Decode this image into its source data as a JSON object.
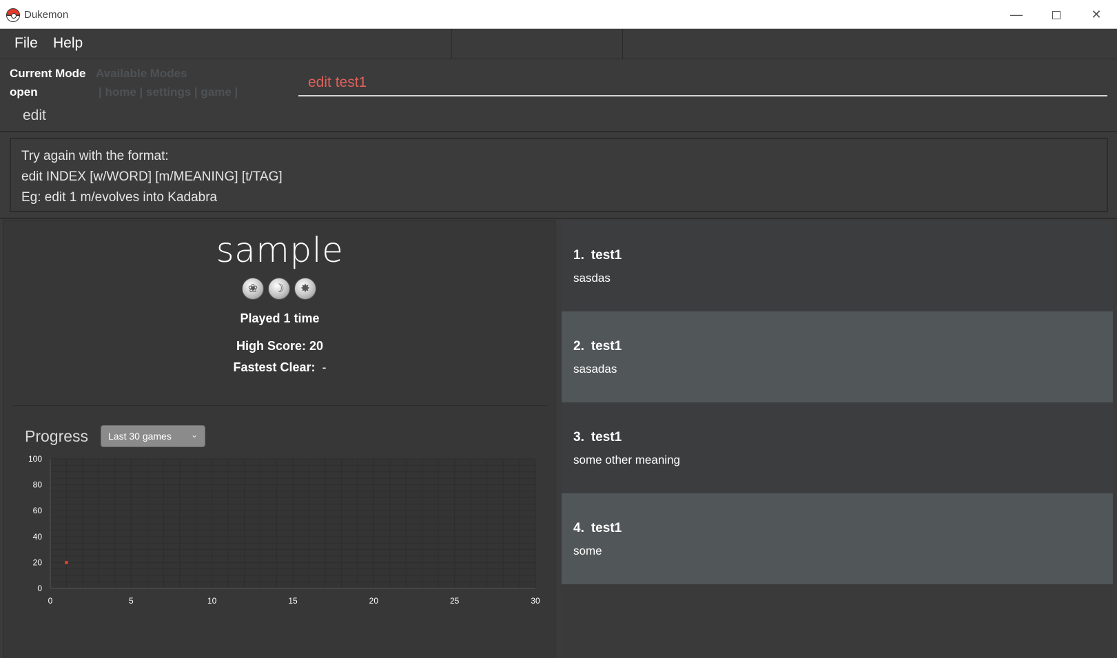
{
  "window": {
    "title": "Dukemon"
  },
  "menu": {
    "file": "File",
    "help": "Help"
  },
  "mode": {
    "current_label": "Current Mode",
    "current_value": "open",
    "available_label": "Available Modes",
    "available_value": "| home | settings | game |",
    "suggestion": "edit"
  },
  "command": {
    "value": "edit test1"
  },
  "result": {
    "lines": [
      "Try again with the format:",
      "edit INDEX [w/WORD] [m/MEANING] [t/TAG]",
      "Eg: edit 1 m/evolves into Kadabra"
    ]
  },
  "bank": {
    "title": "sample",
    "icons": [
      "grass-type-icon",
      "water-type-icon",
      "fire-type-icon"
    ],
    "played": "Played 1 time",
    "high_score_label": "High Score:",
    "high_score_value": "20",
    "fastest_label": "Fastest Clear:",
    "fastest_value": "-",
    "progress_label": "Progress",
    "range_selected": "Last 30 games"
  },
  "chart_data": {
    "type": "scatter",
    "x": [
      1
    ],
    "y": [
      20
    ],
    "xlim": [
      0,
      30
    ],
    "ylim": [
      0,
      100
    ],
    "xticks": [
      0,
      5,
      10,
      15,
      20,
      25,
      30
    ],
    "yticks": [
      0,
      20,
      40,
      60,
      80,
      100
    ],
    "grid": true,
    "color": "#e0442a"
  },
  "cards": [
    {
      "index": "1.",
      "word": "test1",
      "meaning": "sasdas"
    },
    {
      "index": "2.",
      "word": "test1",
      "meaning": "sasadas"
    },
    {
      "index": "3.",
      "word": "test1",
      "meaning": "some other meaning"
    },
    {
      "index": "4.",
      "word": "test1",
      "meaning": "some"
    }
  ]
}
